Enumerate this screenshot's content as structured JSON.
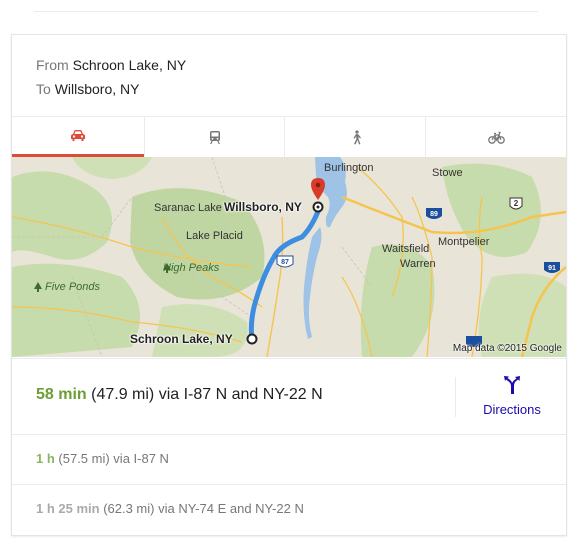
{
  "route": {
    "from_label": "From",
    "from_place": "Schroon Lake, NY",
    "to_label": "To",
    "to_place": "Willsboro, NY"
  },
  "tabs": [
    {
      "name": "car",
      "icon": "car-icon",
      "selected": true
    },
    {
      "name": "transit",
      "icon": "train-icon",
      "selected": false
    },
    {
      "name": "walk",
      "icon": "walking-icon",
      "selected": false
    },
    {
      "name": "bike",
      "icon": "bicycle-icon",
      "selected": false
    }
  ],
  "map": {
    "labels": {
      "burlington": "Burlington",
      "stowe": "Stowe",
      "saranac_lake": "Saranac Lake",
      "lake_placid": "Lake Placid",
      "high_peaks": "High Peaks",
      "five_ponds": "Five Ponds",
      "waitsfield": "Waitsfield",
      "montpelier": "Montpelier",
      "warren": "Warren"
    },
    "destination": "Willsboro, NY",
    "origin": "Schroon Lake, NY",
    "shields": {
      "i87": "87",
      "i89": "89",
      "i91": "91",
      "us2": "2"
    },
    "attribution": "Map data ©2015 Google",
    "colors": {
      "route": "#3d8ee0",
      "marker": "#d93b2b",
      "land": "#e8e4d8",
      "forest": "#bfd6a3",
      "water": "#9ec3e6",
      "highway": "#f6c44e"
    }
  },
  "primary_route": {
    "time": "58 min",
    "details": " (47.9 mi) via I-87 N and NY-22 N",
    "directions_label": "Directions"
  },
  "alternates": [
    {
      "time": "1 h",
      "details": " (57.5 mi) via I-87 N"
    },
    {
      "time": "1 h 25 min",
      "details": " (62.3 mi) via NY-74 E and NY-22 N"
    }
  ]
}
